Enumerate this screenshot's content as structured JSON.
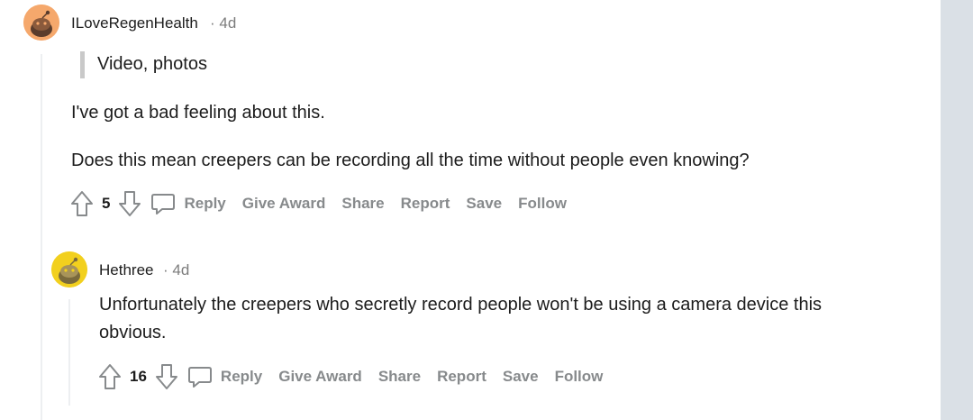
{
  "comments": [
    {
      "username": "ILoveRegenHealth",
      "age": "· 4d",
      "quote": "Video, photos",
      "paragraphs": [
        "I've got a bad feeling about this.",
        "Does this mean creepers can be recording all the time without people even knowing?"
      ],
      "votes": "5"
    },
    {
      "username": "Hethree",
      "age": "· 4d",
      "paragraphs": [
        "Unfortunately the creepers who secretly record people won't be using a camera device this",
        "obvious."
      ],
      "votes": "16"
    }
  ],
  "actions": {
    "reply": "Reply",
    "give_award": "Give Award",
    "share": "Share",
    "report": "Report",
    "save": "Save",
    "follow": "Follow"
  },
  "icons": {
    "avatar_1": "snoo-avatar-orange",
    "avatar_2": "snoo-avatar-yellow",
    "upvote": "upvote-arrow-icon",
    "downvote": "downvote-arrow-icon",
    "reply": "speech-bubble-icon"
  },
  "colors": {
    "avatar_1_bg": "#f5a86c",
    "avatar_2_bg": "#f2d01e",
    "action_gray": "#878a8c",
    "gutter": "#dae0e6"
  }
}
